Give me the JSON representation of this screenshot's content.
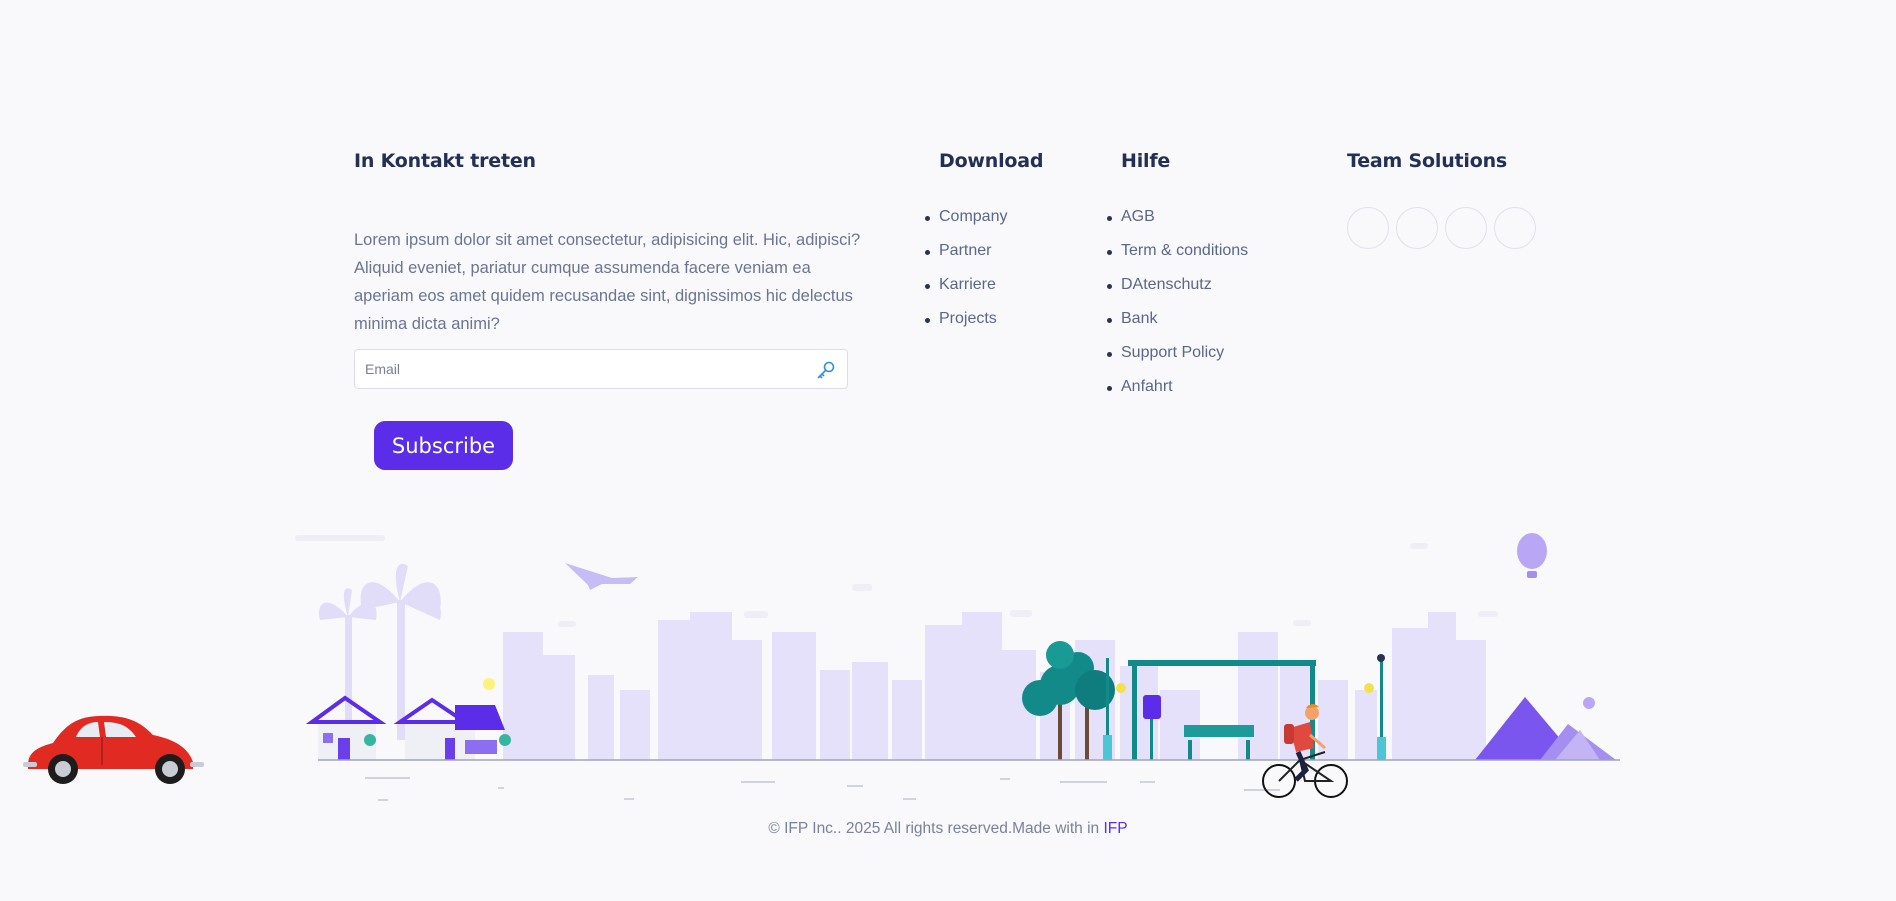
{
  "contact": {
    "heading": "In Kontakt treten",
    "text": "Lorem ipsum dolor sit amet consectetur, adipisicing elit. Hic, adipisci? Aliquid eveniet, pariatur cumque assumenda facere veniam ea aperiam eos amet quidem recusandae sint, dignissimos hic delectus minima dicta animi?",
    "email_placeholder": "Email",
    "subscribe_label": "Subscribe",
    "email_icon": "key-icon"
  },
  "download": {
    "heading": "Download",
    "items": [
      "Company",
      "Partner",
      "Karriere",
      "Projects"
    ]
  },
  "help": {
    "heading": "Hilfe",
    "items": [
      "AGB",
      "Term & conditions",
      "DAtenschutz",
      "Bank",
      "Support Policy",
      "Anfahrt"
    ]
  },
  "team": {
    "heading": "Team Solutions",
    "socials": [
      "social-link-1",
      "social-link-2",
      "social-link-3",
      "social-link-4"
    ]
  },
  "footer": {
    "copyright": "© IFP Inc.. 2025 All rights reserved.Made with in ",
    "brand": "IFP"
  },
  "colors": {
    "accent": "#5b2de8",
    "heading": "#223055",
    "text": "#6c7493",
    "skyline": "#e6e1fb",
    "teal": "#138a8a"
  }
}
